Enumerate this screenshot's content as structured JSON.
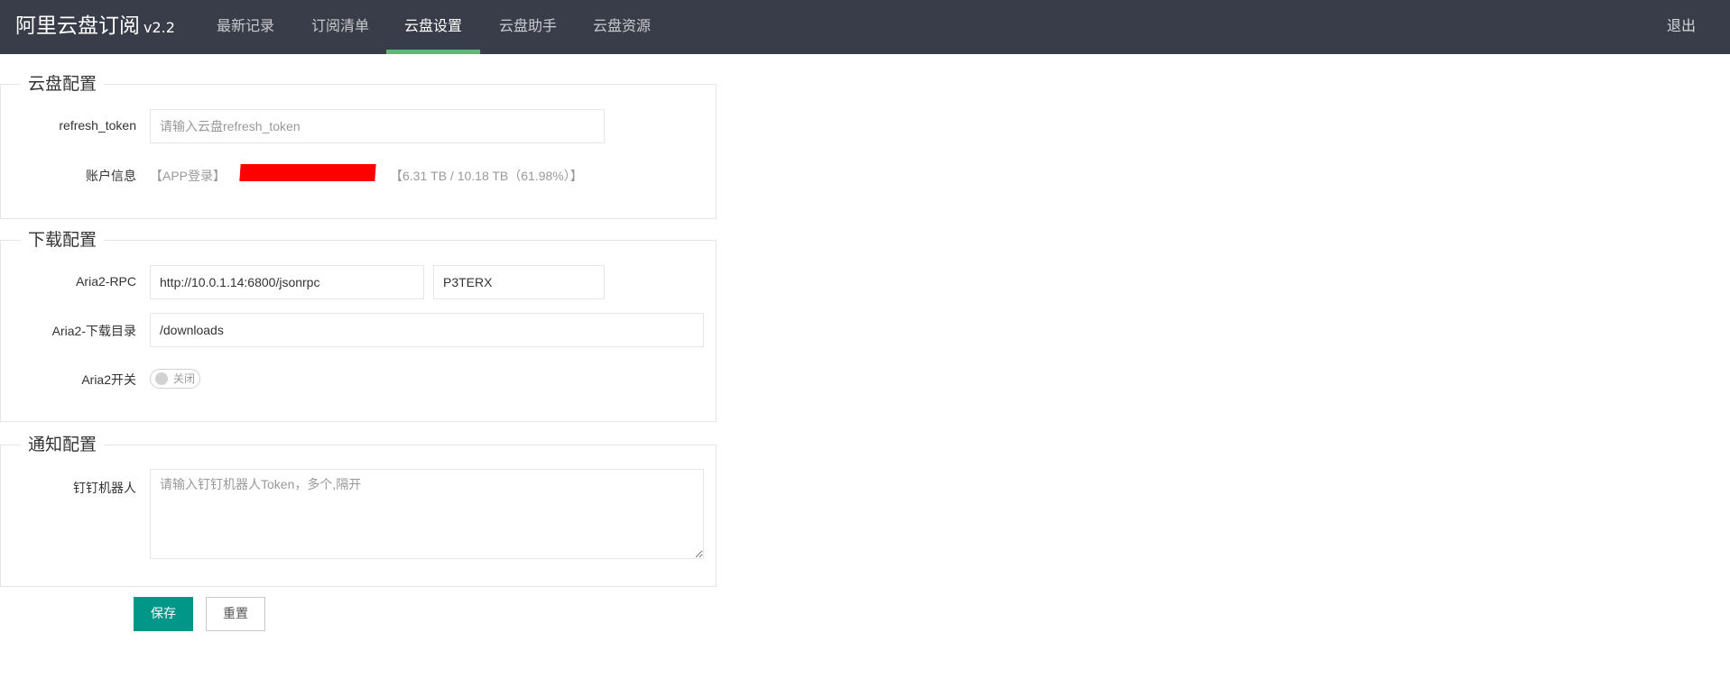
{
  "header": {
    "title": "阿里云盘订阅",
    "version": "v2.2",
    "nav": [
      {
        "label": "最新记录"
      },
      {
        "label": "订阅清单"
      },
      {
        "label": "云盘设置"
      },
      {
        "label": "云盘助手"
      },
      {
        "label": "云盘资源"
      }
    ],
    "active_tab": "云盘设置",
    "logout_label": "退出"
  },
  "cloud_config": {
    "legend": "云盘配置",
    "refresh_token_label": "refresh_token",
    "refresh_token_placeholder": "请输入云盘refresh_token",
    "refresh_token_value": "",
    "account_info_label": "账户信息",
    "login_type": "【APP登录】",
    "storage": "【6.31 TB / 10.18 TB（61.98%）】"
  },
  "download_config": {
    "legend": "下载配置",
    "rpc_label": "Aria2-RPC",
    "rpc_url": "http://10.0.1.14:6800/jsonrpc",
    "rpc_secret": "P3TERX",
    "dir_label": "Aria2-下载目录",
    "dir_value": "/downloads",
    "switch_label": "Aria2开关",
    "switch_text": "关闭",
    "switch_on": false
  },
  "notify_config": {
    "legend": "通知配置",
    "dingtalk_label": "钉钉机器人",
    "dingtalk_placeholder": "请输入钉钉机器人Token，多个,隔开"
  },
  "actions": {
    "save_label": "保存",
    "reset_label": "重置"
  },
  "colors": {
    "header_bg": "#393d49",
    "active_underline": "#5fb878",
    "primary": "#009688",
    "redaction": "#ff0000"
  }
}
